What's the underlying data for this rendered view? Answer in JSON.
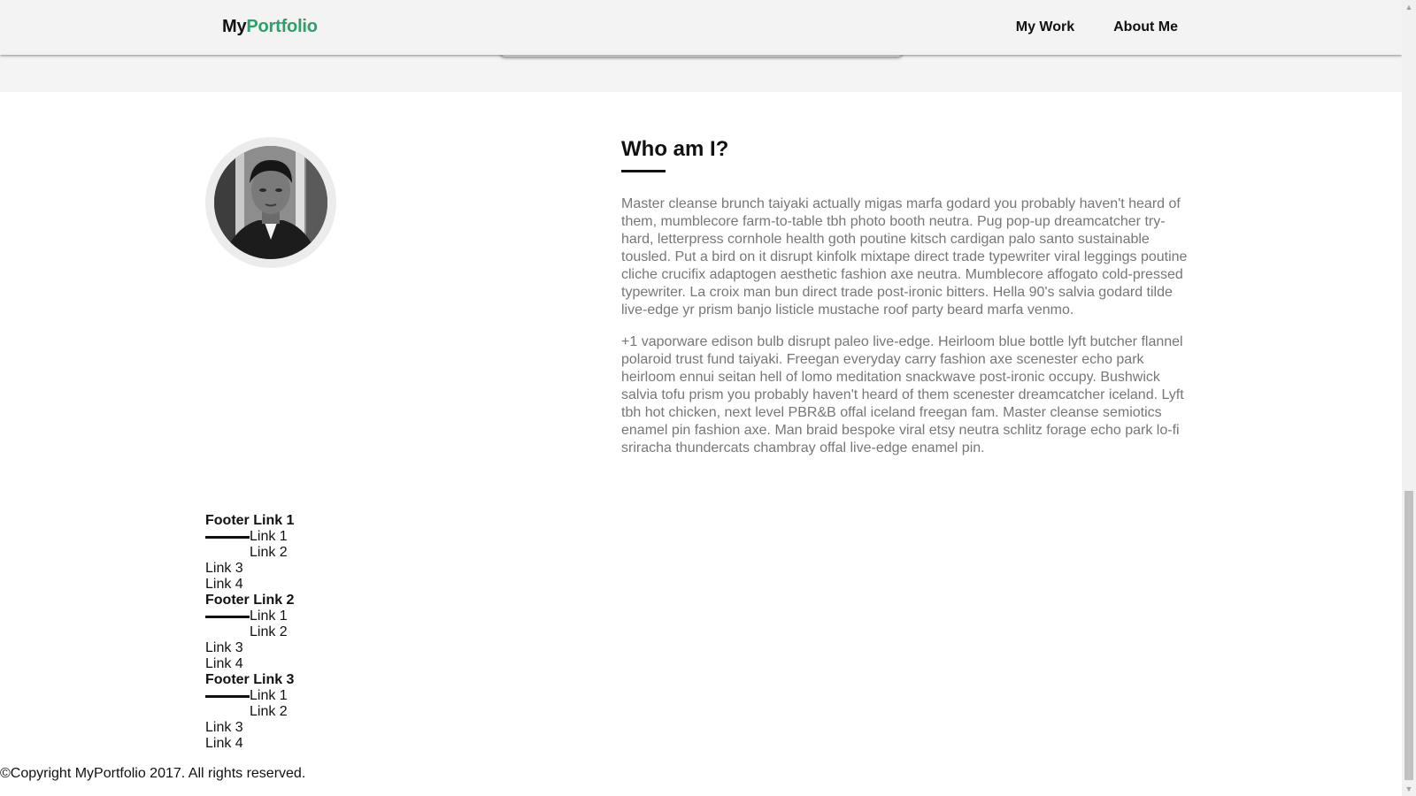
{
  "nav": {
    "brand_part1": "My",
    "brand_part2": "Portfolio",
    "links": [
      {
        "label": "My Work"
      },
      {
        "label": "About Me"
      }
    ]
  },
  "about": {
    "heading": "Who am I?",
    "paragraph1": "Master cleanse brunch taiyaki actually migas marfa godard you probably haven't heard of them, mumblecore farm-to-table tbh photo booth neutra. Pug pop-up dreamcatcher try-hard, letterpress cornhole health goth poutine kitsch cardigan palo santo sustainable tousled. Put a bird on it disrupt kinfolk mixtape direct trade typewriter viral leggings poutine cliche crucifix adaptogen aesthetic fashion axe neutra. Mumblecore affogato cold-pressed typewriter. La croix man bun direct trade post-ironic bitters. Hella 90's salvia godard tilde live-edge yr prism banjo listicle mustache roof party beard marfa venmo.",
    "paragraph2": "+1 vaporware edison bulb disrupt paleo live-edge. Heirloom blue bottle lyft butcher flannel polaroid trust fund taiyaki. Freegan everyday carry fashion axe scenester echo park heirloom ennui seitan hell of lomo meditation snackwave post-ironic occupy. Bushwick salvia tofu prism you probably haven't heard of them scenester dreamcatcher iceland. Lyft tbh hot chicken, next level PBR&B offal iceland freegan fam. Master cleanse semiotics enamel pin fashion axe. Man braid bespoke viral etsy neutra schlitz forage echo park lo-fi sriracha thundercats chambray offal live-edge enamel pin."
  },
  "footer": {
    "groups": [
      {
        "title": "Footer Link 1",
        "links": [
          "Link 1",
          "Link 2",
          "Link 3",
          "Link 4"
        ]
      },
      {
        "title": "Footer Link 2",
        "links": [
          "Link 1",
          "Link 2",
          "Link 3",
          "Link 4"
        ]
      },
      {
        "title": "Footer Link 3",
        "links": [
          "Link 1",
          "Link 2",
          "Link 3",
          "Link 4"
        ]
      }
    ],
    "copyright": "©Copyright MyPortfolio 2017. All rights reserved."
  },
  "colors": {
    "brand_accent": "#2e9e6a",
    "nav_background": "#f3f3f3",
    "body_text": "#777777"
  }
}
